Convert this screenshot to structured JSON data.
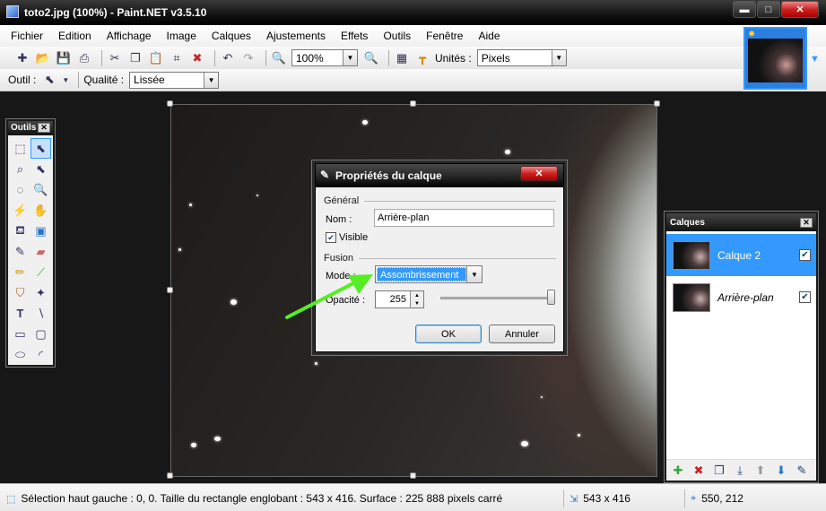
{
  "window": {
    "title": "toto2.jpg (100%) - Paint.NET v3.5.10",
    "minimize": "▬",
    "maximize": "□",
    "close": "✕"
  },
  "menu": [
    {
      "label": "Fichier"
    },
    {
      "label": "Edition"
    },
    {
      "label": "Affichage"
    },
    {
      "label": "Image"
    },
    {
      "label": "Calques"
    },
    {
      "label": "Ajustements"
    },
    {
      "label": "Effets"
    },
    {
      "label": "Outils"
    },
    {
      "label": "Fenêtre"
    },
    {
      "label": "Aide"
    }
  ],
  "toolbar": {
    "zoom_value": "100%",
    "units_label": "Unités :",
    "units_value": "Pixels",
    "tool_label": "Outil :",
    "quality_label": "Qualité :",
    "quality_value": "Lissée"
  },
  "tools_panel": {
    "title": "Outils",
    "close": "✕"
  },
  "layers_panel": {
    "title": "Calques",
    "close": "✕",
    "layers": [
      {
        "name": "Calque 2",
        "visible": true,
        "active": true
      },
      {
        "name": "Arrière-plan",
        "visible": true,
        "active": false
      }
    ]
  },
  "dialog": {
    "title": "Propriétés du calque",
    "close": "✕",
    "general_group": "Général",
    "name_label": "Nom :",
    "name_value": "Arrière-plan",
    "visible_label": "Visible",
    "visible_checked": true,
    "blend_group": "Fusion",
    "mode_label": "Mode :",
    "mode_value": "Assombrissement",
    "opacity_label": "Opacité :",
    "opacity_value": "255",
    "ok_label": "OK",
    "cancel_label": "Annuler"
  },
  "status": {
    "selection_text": "Sélection haut gauche : 0, 0. Taille du rectangle englobant : 543 x 416. Surface : 225 888 pixels carré",
    "image_size": "543 x 416",
    "cursor_pos": "550, 212"
  },
  "colors": {
    "accent": "#3399ff",
    "arrow": "#55ee22",
    "chrome_dark": "#111111"
  }
}
